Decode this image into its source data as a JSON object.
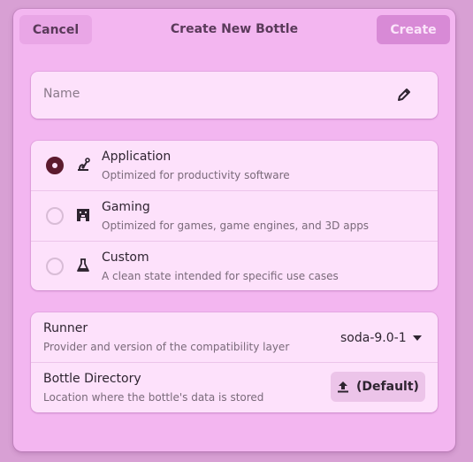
{
  "header": {
    "cancel_label": "Cancel",
    "title": "Create New Bottle",
    "create_label": "Create"
  },
  "name_field": {
    "placeholder": "Name",
    "value": "",
    "edit_icon": "pencil-icon"
  },
  "environment_types": [
    {
      "title": "Application",
      "subtitle": "Optimized for productivity software",
      "icon": "application-icon",
      "selected": true
    },
    {
      "title": "Gaming",
      "subtitle": "Optimized for games, game engines, and 3D apps",
      "icon": "gamepad-icon",
      "selected": false
    },
    {
      "title": "Custom",
      "subtitle": "A clean state intended for specific use cases",
      "icon": "flask-icon",
      "selected": false
    }
  ],
  "settings": {
    "runner": {
      "title": "Runner",
      "subtitle": "Provider and version of the compatibility layer",
      "value": "soda-9.0-1"
    },
    "directory": {
      "title": "Bottle Directory",
      "subtitle": "Location where the bottle's data is stored",
      "button_label": "(Default)"
    }
  },
  "colors": {
    "background": "#d8a0d4",
    "window": "#f3b6f0",
    "card": "#fde1fb",
    "accent_selected": "#5c1a2e",
    "create_button": "#d88ad6"
  }
}
